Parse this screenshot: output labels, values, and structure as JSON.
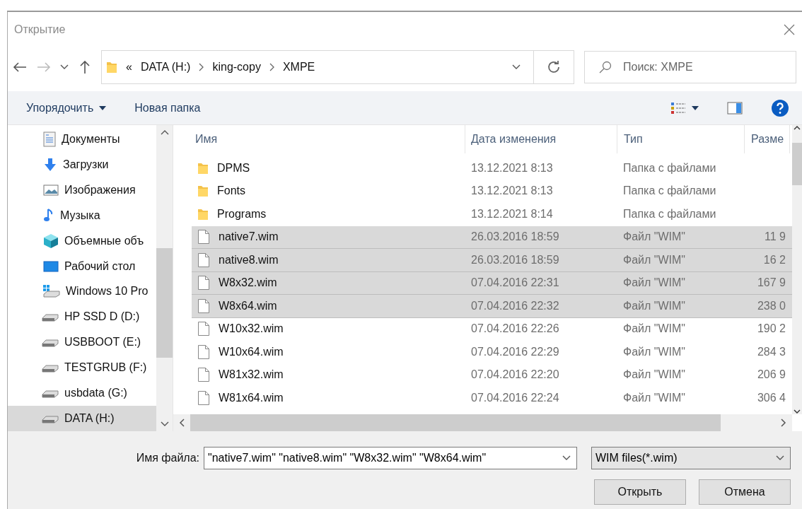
{
  "window": {
    "title": "Открытие"
  },
  "breadcrumb": {
    "overflow": "«",
    "segments": [
      "DATA (H:)",
      "king-copy",
      "XMPE"
    ]
  },
  "search": {
    "placeholder": "Поиск: XMPE"
  },
  "toolbar": {
    "organize": "Упорядочить",
    "new_folder": "Новая папка"
  },
  "sidebar": {
    "items": [
      {
        "kind": "documents",
        "label": "Документы",
        "selected": false
      },
      {
        "kind": "downloads",
        "label": "Загрузки",
        "selected": false
      },
      {
        "kind": "pictures",
        "label": "Изображения",
        "selected": false
      },
      {
        "kind": "music",
        "label": "Музыка",
        "selected": false
      },
      {
        "kind": "objects3d",
        "label": "Объемные объ",
        "selected": false
      },
      {
        "kind": "desktop",
        "label": "Рабочий стол",
        "selected": false
      },
      {
        "kind": "windrive",
        "label": "Windows 10 Pro",
        "selected": false
      },
      {
        "kind": "drive",
        "label": "HP SSD D (D:)",
        "selected": false
      },
      {
        "kind": "drive",
        "label": "USBBOOT (E:)",
        "selected": false
      },
      {
        "kind": "drive",
        "label": "TESTGRUB (F:)",
        "selected": false
      },
      {
        "kind": "drive",
        "label": "usbdata (G:)",
        "selected": false
      },
      {
        "kind": "drive",
        "label": "DATA (H:)",
        "selected": true
      }
    ]
  },
  "table": {
    "columns": [
      "Имя",
      "Дата изменения",
      "Тип",
      "Разме"
    ],
    "rows": [
      {
        "kind": "folder",
        "name": "DPMS",
        "date": "13.12.2021 8:13",
        "type": "Папка с файлами",
        "selected": false
      },
      {
        "kind": "folder",
        "name": "Fonts",
        "date": "13.12.2021 8:13",
        "type": "Папка с файлами",
        "selected": false
      },
      {
        "kind": "folder",
        "name": "Programs",
        "date": "13.12.2021 8:14",
        "type": "Папка с файлами",
        "selected": false
      },
      {
        "kind": "file",
        "name": "native7.wim",
        "date": "26.03.2016 18:59",
        "type": "Файл \"WIM\"",
        "size": "11 9",
        "selected": true
      },
      {
        "kind": "file",
        "name": "native8.wim",
        "date": "26.03.2016 18:59",
        "type": "Файл \"WIM\"",
        "size": "16 2",
        "selected": true
      },
      {
        "kind": "file",
        "name": "W8x32.wim",
        "date": "07.04.2016 22:31",
        "type": "Файл \"WIM\"",
        "size": "167 9",
        "selected": true
      },
      {
        "kind": "file",
        "name": "W8x64.wim",
        "date": "07.04.2016 22:32",
        "type": "Файл \"WIM\"",
        "size": "238 0",
        "selected": true
      },
      {
        "kind": "file",
        "name": "W10x32.wim",
        "date": "07.04.2016 22:26",
        "type": "Файл \"WIM\"",
        "size": "190 2",
        "selected": false
      },
      {
        "kind": "file",
        "name": "W10x64.wim",
        "date": "07.04.2016 22:29",
        "type": "Файл \"WIM\"",
        "size": "284 3",
        "selected": false
      },
      {
        "kind": "file",
        "name": "W81x32.wim",
        "date": "07.04.2016 22:20",
        "type": "Файл \"WIM\"",
        "size": "206 9",
        "selected": false
      },
      {
        "kind": "file",
        "name": "W81x64.wim",
        "date": "07.04.2016 22:24",
        "type": "Файл \"WIM\"",
        "size": "306 4",
        "selected": false
      }
    ]
  },
  "filename": {
    "label": "Имя файла:",
    "value": "\"native7.wim\" \"native8.wim\" \"W8x32.wim\" \"W8x64.wim\""
  },
  "filter": {
    "value": "WIM files(*.wim)"
  },
  "buttons": [
    "Открыть",
    "Отмена"
  ]
}
